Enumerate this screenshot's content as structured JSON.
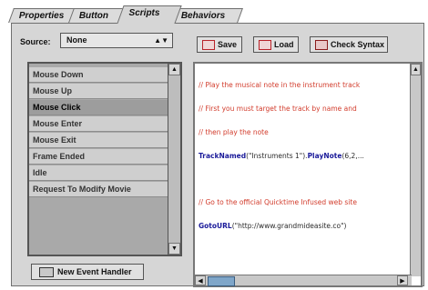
{
  "tabs": [
    {
      "label": "Properties"
    },
    {
      "label": "Button"
    },
    {
      "label": "Scripts"
    },
    {
      "label": "Behaviors"
    }
  ],
  "source": {
    "label": "Source:",
    "value": "None"
  },
  "events": [
    {
      "label": "Mouse Down"
    },
    {
      "label": "Mouse Up"
    },
    {
      "label": "Mouse Click"
    },
    {
      "label": "Mouse Enter"
    },
    {
      "label": "Mouse Exit"
    },
    {
      "label": "Frame Ended"
    },
    {
      "label": "Idle"
    },
    {
      "label": "Request To Modify Movie"
    }
  ],
  "selected_event": "Mouse Click",
  "buttons": {
    "new_event": "New Event Handler",
    "save": "Save",
    "load": "Load",
    "check_syntax": "Check Syntax"
  },
  "code_lines": [
    {
      "kind": "comment",
      "text": "// Play the musical note in the instrument track"
    },
    {
      "kind": "comment",
      "text": "// First you must target the track by name and"
    },
    {
      "kind": "comment",
      "text": "// then play the note"
    },
    {
      "kind": "mixed",
      "a": "TrackNamed",
      "b": "(\"Instruments 1\").",
      "c": "PlayNote",
      "d": "(6,2,..."
    },
    {
      "kind": "blank",
      "text": ""
    },
    {
      "kind": "comment",
      "text": "// Go to the official Quicktime Infused web site"
    },
    {
      "kind": "mixed",
      "a": "GotoURL",
      "b": "(\"http://www.grandmideasite.co\")",
      "c": "",
      "d": ""
    }
  ],
  "colors": {
    "comment": "#d23c2c",
    "keyword": "#1b1b9a"
  }
}
